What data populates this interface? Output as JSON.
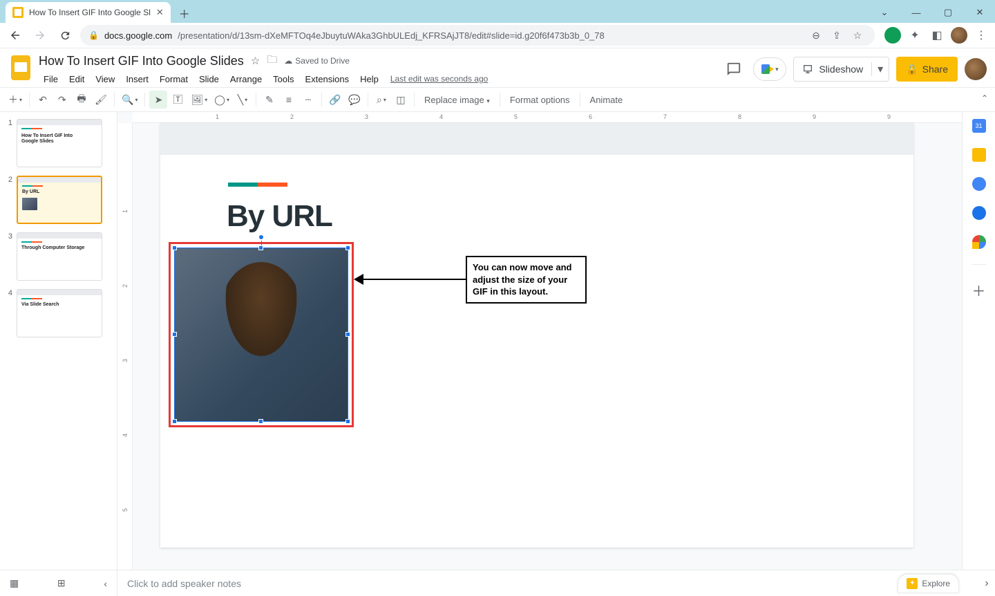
{
  "browser": {
    "tab_title": "How To Insert GIF Into Google Sl",
    "url_host": "docs.google.com",
    "url_path": "/presentation/d/13sm-dXeMFTOq4eJbuytuWAka3GhbULEdj_KFRSAjJT8/edit#slide=id.g20f6f473b3b_0_78"
  },
  "doc": {
    "title": "How To Insert GIF Into Google Slides",
    "saved_status": "Saved to Drive",
    "last_edit": "Last edit was seconds ago"
  },
  "menus": [
    "File",
    "Edit",
    "View",
    "Insert",
    "Format",
    "Slide",
    "Arrange",
    "Tools",
    "Extensions",
    "Help"
  ],
  "header_actions": {
    "slideshow": "Slideshow",
    "share": "Share"
  },
  "toolbar": {
    "replace_image": "Replace image",
    "format_options": "Format options",
    "animate": "Animate"
  },
  "filmstrip": [
    {
      "num": "1",
      "title": "How To Insert GIF Into Google Slides"
    },
    {
      "num": "2",
      "title": "By URL"
    },
    {
      "num": "3",
      "title": "Through Computer Storage"
    },
    {
      "num": "4",
      "title": "Via Slide Search"
    }
  ],
  "slide": {
    "title": "By URL",
    "callout": "You can now move and adjust the size of your GIF in this layout."
  },
  "ruler_h": [
    "1",
    "2",
    "3",
    "4",
    "5",
    "6",
    "7",
    "8",
    "9",
    "9"
  ],
  "ruler_v": [
    "1",
    "2",
    "3",
    "4",
    "5"
  ],
  "speaker_notes_placeholder": "Click to add speaker notes",
  "explore": "Explore"
}
